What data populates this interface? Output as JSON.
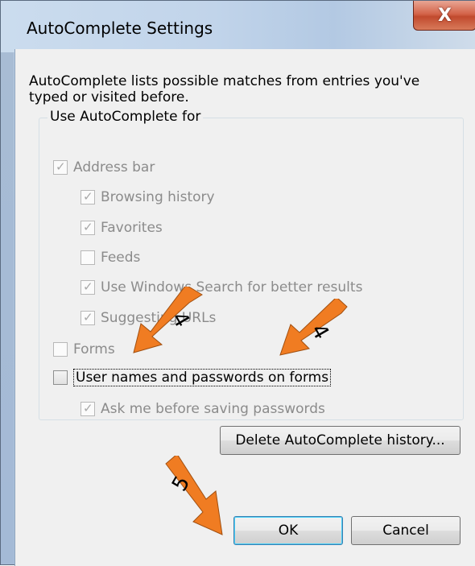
{
  "window": {
    "title": "AutoComplete Settings",
    "close_label": "X"
  },
  "description": "AutoComplete lists possible matches from entries you've typed or visited before.",
  "group": {
    "label": "Use AutoComplete for",
    "items": [
      {
        "label": "Address bar",
        "checked": true,
        "enabled": false
      },
      {
        "label": "Browsing history",
        "checked": true,
        "enabled": false
      },
      {
        "label": "Favorites",
        "checked": true,
        "enabled": false
      },
      {
        "label": "Feeds",
        "checked": false,
        "enabled": false
      },
      {
        "label": "Use Windows Search for better results",
        "checked": true,
        "enabled": false
      },
      {
        "label": "Suggesting URLs",
        "checked": true,
        "enabled": false
      },
      {
        "label": "Forms",
        "checked": false,
        "enabled": false
      },
      {
        "label": "User names and passwords on forms",
        "checked": false,
        "enabled": true
      },
      {
        "label": "Ask me before saving passwords",
        "checked": true,
        "enabled": false
      }
    ]
  },
  "buttons": {
    "delete_history": "Delete AutoComplete history...",
    "ok": "OK",
    "cancel": "Cancel"
  },
  "annotations": {
    "step_4": "4",
    "step_5": "5",
    "arrow_color": "#f07c22"
  }
}
